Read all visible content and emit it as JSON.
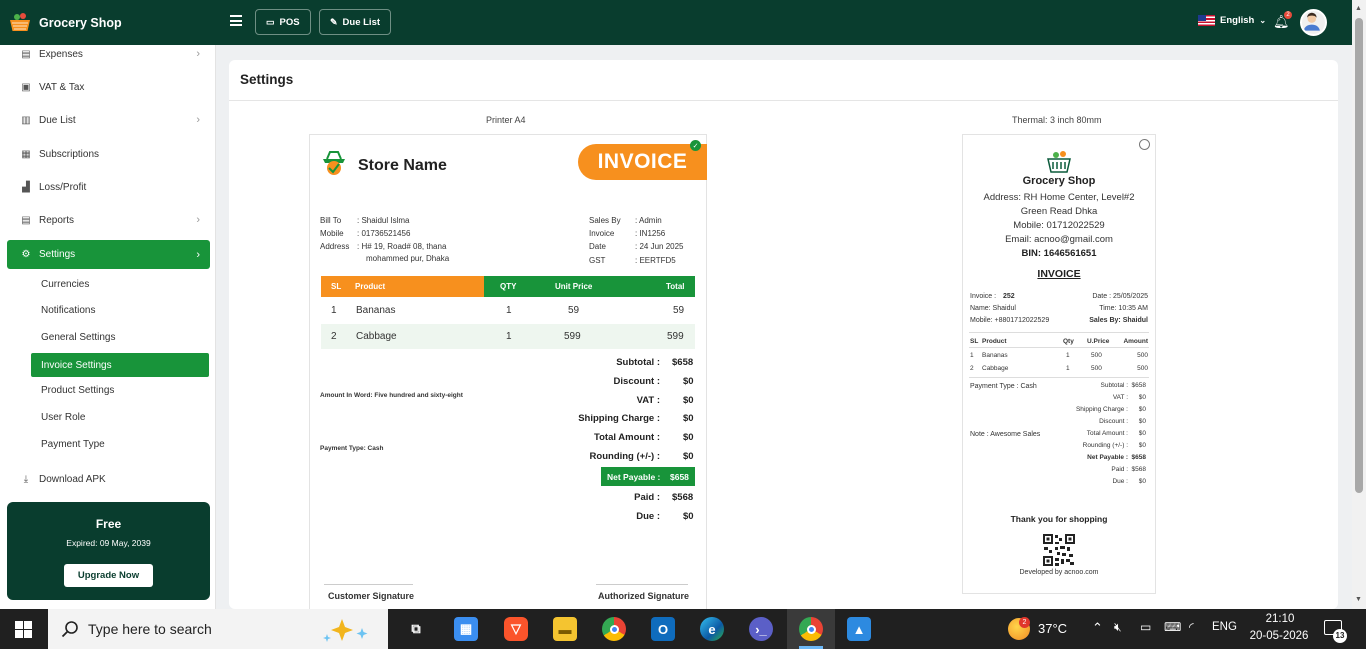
{
  "app": {
    "name": "Grocery Shop"
  },
  "sidebar": {
    "items": [
      {
        "label": "Expenses",
        "icon": "expenses-icon",
        "has_children": true
      },
      {
        "label": "VAT & Tax",
        "icon": "vat-tax-icon",
        "has_children": false
      },
      {
        "label": "Due List",
        "icon": "due-list-icon",
        "has_children": true
      },
      {
        "label": "Subscriptions",
        "icon": "subscriptions-icon",
        "has_children": false
      },
      {
        "label": "Loss/Profit",
        "icon": "chart-icon",
        "has_children": false
      },
      {
        "label": "Reports",
        "icon": "reports-icon",
        "has_children": true
      },
      {
        "label": "Settings",
        "icon": "gear-icon",
        "has_children": true,
        "active": true
      }
    ],
    "settings_sub": [
      {
        "label": "Currencies"
      },
      {
        "label": "Notifications"
      },
      {
        "label": "General Settings"
      },
      {
        "label": "Invoice Settings",
        "active": true
      },
      {
        "label": "Product Settings"
      },
      {
        "label": "User Role"
      },
      {
        "label": "Payment Type"
      }
    ],
    "download": {
      "label": "Download APK"
    },
    "plan": {
      "title": "Free",
      "expiry": "Expired: 09 May, 2039",
      "button": "Upgrade Now"
    }
  },
  "topbar": {
    "pos_label": "POS",
    "due_list_label": "Due List",
    "language": "English",
    "notification_count": "2"
  },
  "page": {
    "title": "Settings",
    "printer_a4_label": "Printer A4",
    "thermal_label": "Thermal: 3 inch 80mm"
  },
  "a4_invoice": {
    "store_name": "Store Name",
    "banner": "INVOICE",
    "bill_to_label": "Bill To",
    "bill_to": ": Shaidul Islma",
    "mobile_label": "Mobile",
    "mobile": ": 01736521456",
    "address_label": "Address",
    "address_line1": ": H# 19, Road# 08, thana",
    "address_line2": "mohammed pur, Dhaka",
    "sales_by_label": "Sales By",
    "sales_by": ": Admin",
    "invoice_label": "Invoice",
    "invoice": ": IN1256",
    "date_label": "Date",
    "date": ": 24 Jun 2025",
    "gst_label": "GST",
    "gst": ": EERTFD5",
    "headers": {
      "sl": "SL",
      "product": "Product",
      "qty": "QTY",
      "unit_price": "Unit Price",
      "total": "Total"
    },
    "rows": [
      {
        "sl": "1",
        "product": "Bananas",
        "qty": "1",
        "unit_price": "59",
        "total": "59"
      },
      {
        "sl": "2",
        "product": "Cabbage",
        "qty": "1",
        "unit_price": "599",
        "total": "599"
      }
    ],
    "amount_in_word": "Amount In Word: Five hundred and sixty-eight",
    "payment_type": "Payment Type: Cash",
    "summary": [
      {
        "label": "Subtotal :",
        "value": "$658"
      },
      {
        "label": "Discount :",
        "value": "$0"
      },
      {
        "label": "VAT :",
        "value": "$0"
      },
      {
        "label": "Shipping Charge :",
        "value": "$0"
      },
      {
        "label": "Total Amount :",
        "value": "$0"
      },
      {
        "label": "Rounding (+/-) :",
        "value": "$0"
      }
    ],
    "net_payable": {
      "label": "Net Payable :",
      "value": "$658"
    },
    "paid": {
      "label": "Paid :",
      "value": "$568"
    },
    "due": {
      "label": "Due :",
      "value": "$0"
    },
    "customer_signature": "Customer Signature",
    "authorized_signature": "Authorized Signature"
  },
  "thermal_invoice": {
    "shop_name": "Grocery Shop",
    "address1": "Address: RH Home Center, Level#2",
    "address2": "Green Read Dhka",
    "mobile": "Mobile: 01712022529",
    "email": "Email: acnoo@gmail.com",
    "bin": "BIN: 1646561651",
    "title": "INVOICE",
    "invoice_label": "Invoice :",
    "invoice_no": "252",
    "date": "Date : 25/05/2025",
    "name": "Name: Shaidul",
    "time": "Time: 10:35 AM",
    "mobile_cust": "Mobile: +8801712022529",
    "sales_by": "Sales By: Shaidul",
    "headers": {
      "sl": "SL",
      "product": "Product",
      "qty": "Qty",
      "uprice": "U.Price",
      "amount": "Amount"
    },
    "rows": [
      {
        "sl": "1",
        "product": "Bananas",
        "qty": "1",
        "uprice": "500",
        "amount": "500"
      },
      {
        "sl": "2",
        "product": "Cabbage",
        "qty": "1",
        "uprice": "500",
        "amount": "500"
      }
    ],
    "payment_type": "Payment Type : Cash",
    "note": "Note : Awesome Sales",
    "summary": [
      {
        "label": "Subtotal :",
        "value": "$658"
      },
      {
        "label": "VAT :",
        "value": "$0"
      },
      {
        "label": "Shipping Charge :",
        "value": "$0"
      },
      {
        "label": "Discount :",
        "value": "$0"
      },
      {
        "label": "Total Amount :",
        "value": "$0"
      },
      {
        "label": "Rounding (+/-) :",
        "value": "$0"
      },
      {
        "label": "Net Payable :",
        "value": "$658",
        "bold": true
      },
      {
        "label": "Paid :",
        "value": "$568"
      },
      {
        "label": "Due :",
        "value": "$0"
      }
    ],
    "thanks": "Thank you for shopping",
    "developed_by": "Developed by acnoo.com"
  },
  "taskbar": {
    "search_placeholder": "Type here to search",
    "weather": "37°C",
    "language": "ENG",
    "time": "21:10",
    "date": "20-05-2026",
    "notification_count": "13",
    "weather_badge": "2"
  },
  "colors": {
    "primary_dark": "#093d2e",
    "accent_green": "#18943a",
    "orange": "#f7901e"
  }
}
